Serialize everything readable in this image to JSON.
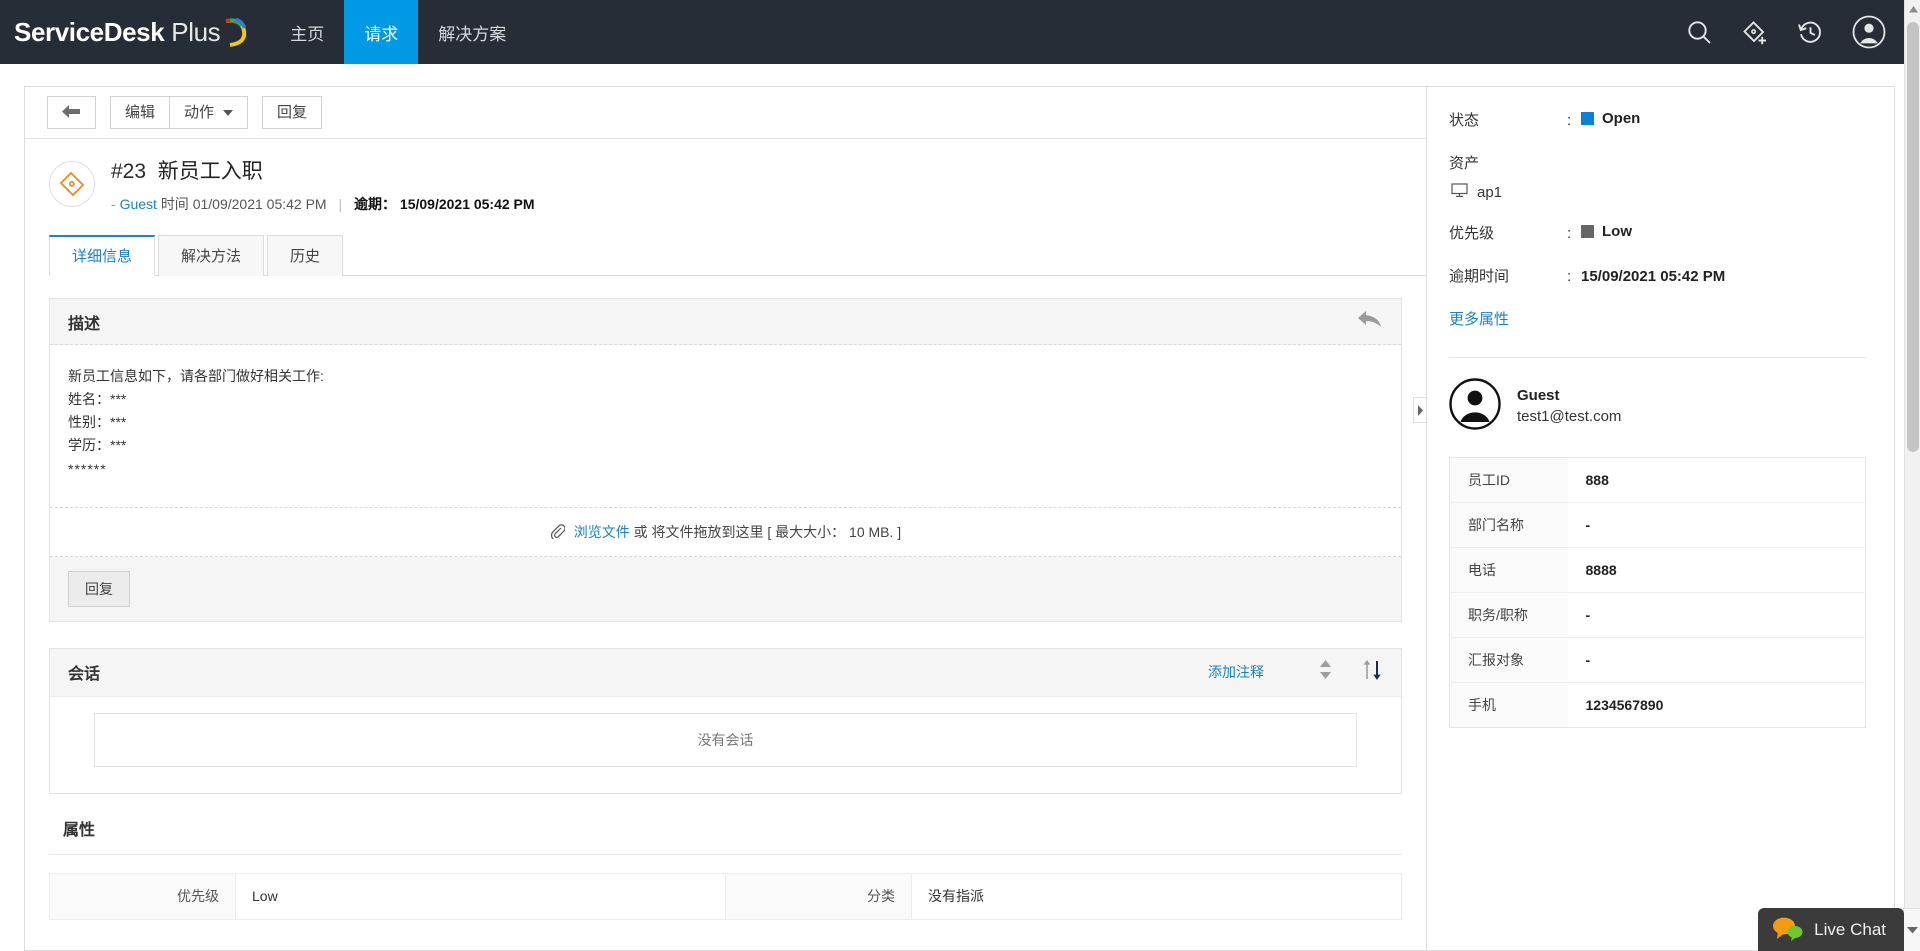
{
  "app": {
    "brand_bold": "ServiceDesk",
    "brand_light": "Plus",
    "nav": [
      {
        "label": "主页",
        "active": false
      },
      {
        "label": "请求",
        "active": true
      },
      {
        "label": "解决方案",
        "active": false
      }
    ],
    "nav_icons": [
      "search-icon",
      "add-ticket-icon",
      "history-icon",
      "user-profile-icon"
    ],
    "accent_color": "#0099e5",
    "navbar_color": "#262d36"
  },
  "toolbar": {
    "back_label": "",
    "edit_label": "编辑",
    "actions_label": "动作",
    "reply_label": "回复"
  },
  "ticket": {
    "id": "#23",
    "subject": "新员工入职",
    "requester": "Guest",
    "created_prefix": "时间",
    "created_at": "01/09/2021 05:42 PM",
    "overdue_label": "逾期",
    "overdue_at": "15/09/2021 05:42 PM"
  },
  "tabs": [
    {
      "label": "详细信息",
      "active": true
    },
    {
      "label": "解决方法",
      "active": false
    },
    {
      "label": "历史",
      "active": false
    }
  ],
  "description": {
    "header": "描述",
    "line1": "新员工信息如下，请各部门做好相关工作:",
    "line2": "姓名：***",
    "line3": "性别：***",
    "line4": "学历：***",
    "line5": "******"
  },
  "upload": {
    "browse_label": "浏览文件",
    "or_label": "或",
    "drop_label": "将文件拖放到这里",
    "size_label": "[ 最大大小： 10 MB. ]"
  },
  "reply": {
    "button_label": "回复"
  },
  "conversation": {
    "header": "会话",
    "add_note_label": "添加注释",
    "empty_label": "没有会话"
  },
  "properties": {
    "header": "属性",
    "rows": [
      {
        "label": "优先级",
        "value": "Low",
        "label2": "分类",
        "value2": "没有指派"
      }
    ]
  },
  "sidebar": {
    "status_label": "状态",
    "status_value": "Open",
    "status_color": "#0b7fdb",
    "asset_label": "资产",
    "asset_value": "ap1",
    "priority_label": "优先级",
    "priority_value": "Low",
    "priority_color": "#666666",
    "overdue_label": "逾期时间",
    "overdue_value": "15/09/2021 05:42 PM",
    "more_properties_label": "更多属性",
    "requester_name": "Guest",
    "requester_email": "test1@test.com",
    "employee_fields": [
      {
        "key": "员工ID",
        "value": "888"
      },
      {
        "key": "部门名称",
        "value": "-"
      },
      {
        "key": "电话",
        "value": "8888"
      },
      {
        "key": "职务/职称",
        "value": "-"
      },
      {
        "key": "汇报对象",
        "value": "-"
      },
      {
        "key": "手机",
        "value": "1234567890"
      }
    ]
  },
  "livechat": {
    "label": "Live Chat"
  }
}
